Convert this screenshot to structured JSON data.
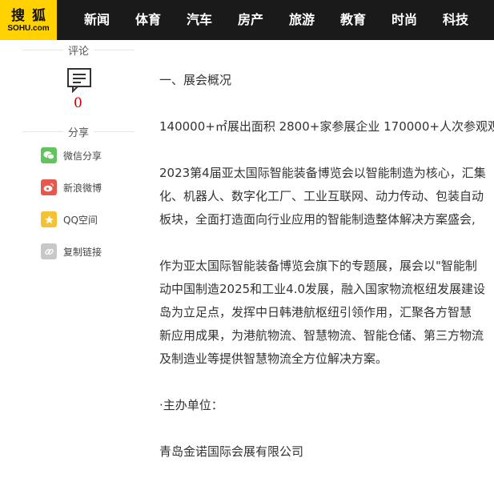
{
  "header": {
    "logo_cn": "搜狐",
    "logo_en": "SOHU.com",
    "nav": [
      "新闻",
      "体育",
      "汽车",
      "房产",
      "旅游",
      "教育",
      "时尚",
      "科技"
    ]
  },
  "sidebar": {
    "comment_label": "评论",
    "comment_count": "0",
    "share_label": "分享",
    "share_items": [
      {
        "label": "微信分享",
        "icon": "wechat-icon",
        "color": "#62c35f"
      },
      {
        "label": "新浪微博",
        "icon": "weibo-icon",
        "color": "#e8574b"
      },
      {
        "label": "QQ空间",
        "icon": "qzone-icon",
        "color": "#f5c233"
      },
      {
        "label": "复制链接",
        "icon": "link-icon",
        "color": "#c8c8c8"
      }
    ]
  },
  "article": {
    "p1": [
      "一、展会概况"
    ],
    "p2": [
      "140000+㎡展出面积 2800+家参展企业 170000+人次参观观"
    ],
    "p3": [
      "2023第4届亚太国际智能装备博览会以智能制造为核心，汇集",
      "化、机器人、数字化工厂、工业互联网、动力传动、包装自动",
      "板块，全面打造面向行业应用的智能制造整体解决方案盛会,"
    ],
    "p4": [
      "作为亚太国际智能装备博览会旗下的专题展，展会以\"智能制",
      "动中国制造2025和工业4.0发展，融入国家物流枢纽发展建设",
      "岛为立足点，发挥中日韩港航枢纽引领作用，汇聚各方智慧",
      "新应用成果，为港航物流、智慧物流、智能仓储、第三方物流",
      "及制造业等提供智慧物流全方位解决方案。"
    ],
    "p5": [
      "·主办单位："
    ],
    "p6": [
      "青岛金诺国际会展有限公司"
    ]
  },
  "colors": {
    "nav_bg": "#1a1a1a",
    "logo_bg": "#ffd200",
    "comment_count": "#cc0000"
  }
}
